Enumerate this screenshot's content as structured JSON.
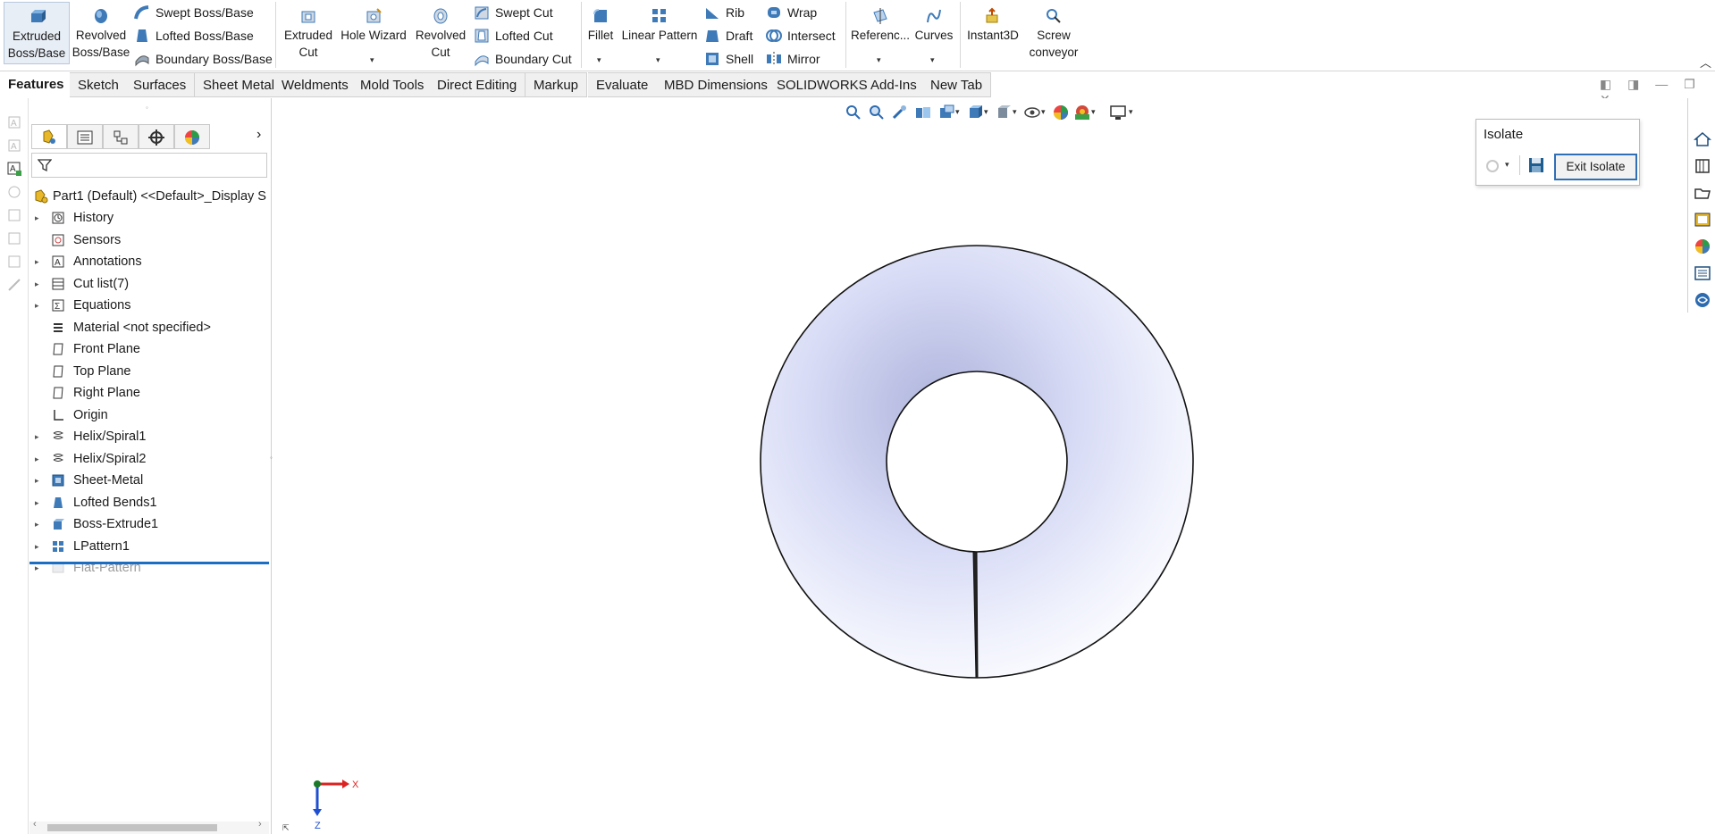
{
  "ribbon": {
    "features": {
      "extruded_boss": "Extruded\nBoss/Base",
      "revolved_boss": "Revolved\nBoss/Base",
      "swept_boss": "Swept Boss/Base",
      "lofted_boss": "Lofted Boss/Base",
      "boundary_boss": "Boundary Boss/Base",
      "extruded_cut": "Extruded\nCut",
      "hole_wizard": "Hole Wizard",
      "revolved_cut": "Revolved\nCut",
      "swept_cut": "Swept Cut",
      "lofted_cut": "Lofted Cut",
      "boundary_cut": "Boundary Cut",
      "fillet": "Fillet",
      "linear_pattern": "Linear Pattern",
      "rib": "Rib",
      "draft": "Draft",
      "shell": "Shell",
      "wrap": "Wrap",
      "intersect": "Intersect",
      "mirror": "Mirror",
      "reference": "Referenc...",
      "curves": "Curves",
      "instant3d": "Instant3D",
      "screw_conveyor": "Screw\nconveyor"
    }
  },
  "tabs": [
    "Features",
    "Sketch",
    "Surfaces",
    "Sheet Metal",
    "Weldments",
    "Mold Tools",
    "Direct Editing",
    "Markup",
    "Evaluate",
    "MBD Dimensions",
    "SOLIDWORKS Add-Ins",
    "New Tab"
  ],
  "tree": {
    "root": "Part1 (Default) <<Default>_Display S",
    "items": [
      {
        "label": "History",
        "icon": "history-icon",
        "expandable": true
      },
      {
        "label": "Sensors",
        "icon": "sensors-icon",
        "expandable": false
      },
      {
        "label": "Annotations",
        "icon": "annotations-icon",
        "expandable": true
      },
      {
        "label": "Cut list(7)",
        "icon": "cut-list-icon",
        "expandable": true
      },
      {
        "label": "Equations",
        "icon": "equations-icon",
        "expandable": true
      },
      {
        "label": "Material <not specified>",
        "icon": "material-icon",
        "expandable": false
      },
      {
        "label": "Front Plane",
        "icon": "plane-icon",
        "expandable": false
      },
      {
        "label": "Top Plane",
        "icon": "plane-icon",
        "expandable": false
      },
      {
        "label": "Right Plane",
        "icon": "plane-icon",
        "expandable": false
      },
      {
        "label": "Origin",
        "icon": "origin-icon",
        "expandable": false
      },
      {
        "label": "Helix/Spiral1",
        "icon": "helix-icon",
        "expandable": true
      },
      {
        "label": "Helix/Spiral2",
        "icon": "helix-icon",
        "expandable": true
      },
      {
        "label": "Sheet-Metal",
        "icon": "sheet-metal-icon",
        "expandable": true
      },
      {
        "label": "Lofted Bends1",
        "icon": "lofted-bends-icon",
        "expandable": true
      },
      {
        "label": "Boss-Extrude1",
        "icon": "extrude-icon",
        "expandable": true
      },
      {
        "label": "LPattern1",
        "icon": "linear-pattern-icon",
        "expandable": true
      },
      {
        "label": "Flat-Pattern",
        "icon": "flat-pattern-icon",
        "expandable": true,
        "suppressed": true
      }
    ]
  },
  "isolate": {
    "title": "Isolate",
    "exit_label": "Exit Isolate"
  },
  "triad": {
    "x": "X",
    "z": "Z"
  },
  "colors": {
    "accent": "#1b6ec2",
    "ring_shade": "#c9cdee",
    "rollback_bar": "#1b6ec2"
  }
}
